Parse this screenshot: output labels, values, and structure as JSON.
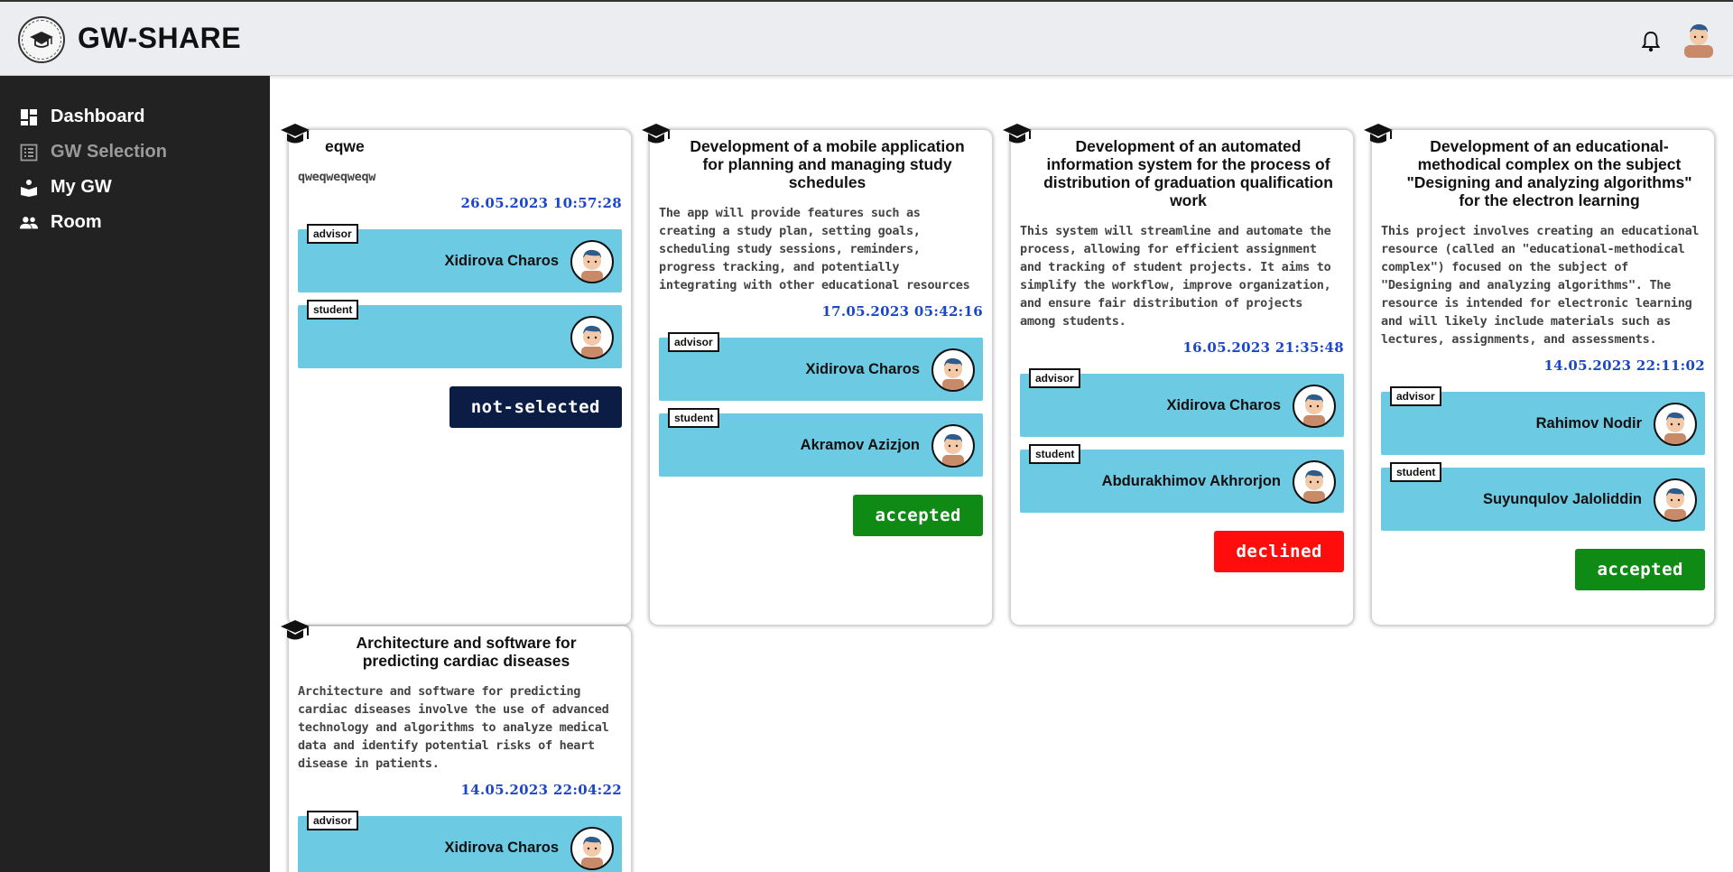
{
  "app": {
    "title": "GW-SHARE"
  },
  "sidebar": {
    "items": [
      {
        "label": "Dashboard",
        "icon": "dashboard-icon",
        "active": true
      },
      {
        "label": "GW Selection",
        "icon": "list-icon",
        "active": false
      },
      {
        "label": "My GW",
        "icon": "reader-icon",
        "active": true
      },
      {
        "label": "Room",
        "icon": "people-icon",
        "active": true
      }
    ]
  },
  "cards": [
    {
      "title": "eqwe",
      "description": "qweqweqweqw",
      "date": "26.05.2023 10:57:28",
      "advisor_role": "advisor",
      "advisor_name": "Xidirova Charos",
      "student_role": "student",
      "student_name": "",
      "status": "not-selected"
    },
    {
      "title": "Development of a mobile application for planning and managing study schedules",
      "description": "The app will provide features such as creating a study plan, setting goals, scheduling study sessions, reminders, progress tracking, and potentially integrating with other educational resources",
      "date": "17.05.2023 05:42:16",
      "advisor_role": "advisor",
      "advisor_name": "Xidirova Charos",
      "student_role": "student",
      "student_name": "Akramov Azizjon",
      "status": "accepted"
    },
    {
      "title": "Development of an automated information system for the process of distribution of graduation qualification work",
      "description": "This system will streamline and automate the process, allowing for efficient assignment and tracking of student projects. It aims to simplify the workflow, improve organization, and ensure fair distribution of projects among students.",
      "date": "16.05.2023 21:35:48",
      "advisor_role": "advisor",
      "advisor_name": "Xidirova Charos",
      "student_role": "student",
      "student_name": "Abdurakhimov Akhrorjon",
      "status": "declined"
    },
    {
      "title": "Development of an educational-methodical complex on the subject \"Designing and analyzing algorithms\" for the electron learning",
      "description": "This project involves creating an educational resource (called an \"educational-methodical complex\") focused on the subject of \"Designing and analyzing algorithms\". The resource is intended for electronic learning and will likely include materials such as lectures, assignments, and assessments.",
      "date": "14.05.2023 22:11:02",
      "advisor_role": "advisor",
      "advisor_name": "Rahimov Nodir",
      "student_role": "student",
      "student_name": "Suyunqulov Jaloliddin",
      "status": "accepted"
    },
    {
      "title": "Architecture and software for predicting cardiac diseases",
      "description": "Architecture and software for predicting cardiac diseases involve the use of advanced technology and algorithms to analyze medical data and identify potential risks of heart disease in patients.",
      "date": "14.05.2023 22:04:22",
      "advisor_role": "advisor",
      "advisor_name": "Xidirova Charos"
    }
  ],
  "colors": {
    "sidebar": "#222222",
    "person_bg": "#6ccae2",
    "date": "#1a46c8",
    "accepted": "#0f8a15",
    "declined": "#ff0d0d",
    "not_selected": "#0b1c45"
  }
}
